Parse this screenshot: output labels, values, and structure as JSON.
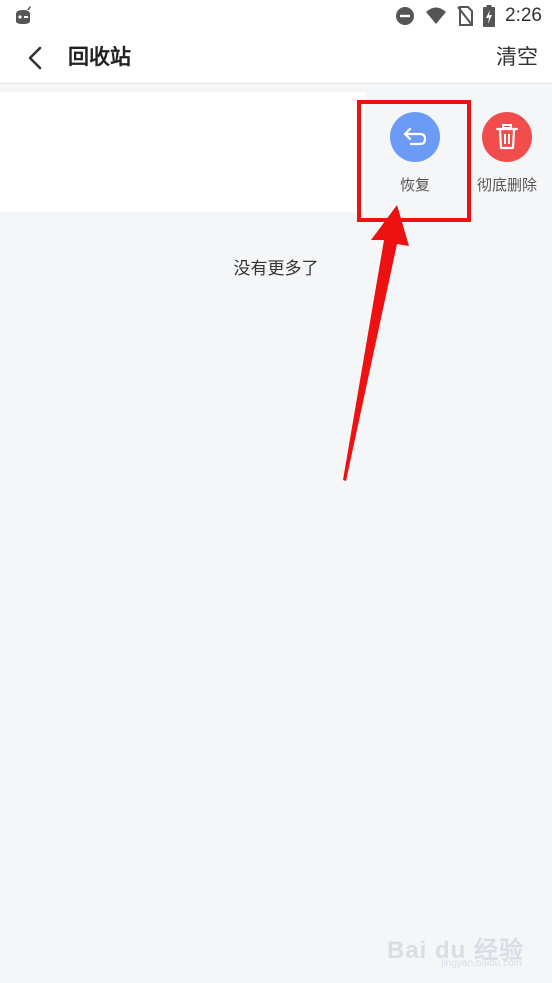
{
  "status_bar": {
    "time": "2:26"
  },
  "header": {
    "title": "回收站",
    "clear_label": "清空"
  },
  "actions": {
    "restore_label": "恢复",
    "delete_label": "彻底删除"
  },
  "list": {
    "footer": "没有更多了"
  },
  "watermark": {
    "brand": "Bai du 经验",
    "url": "jingyan.baidu.com"
  },
  "colors": {
    "restore": "#6b9bf6",
    "delete": "#f24d4d",
    "highlight": "#ee1111"
  }
}
